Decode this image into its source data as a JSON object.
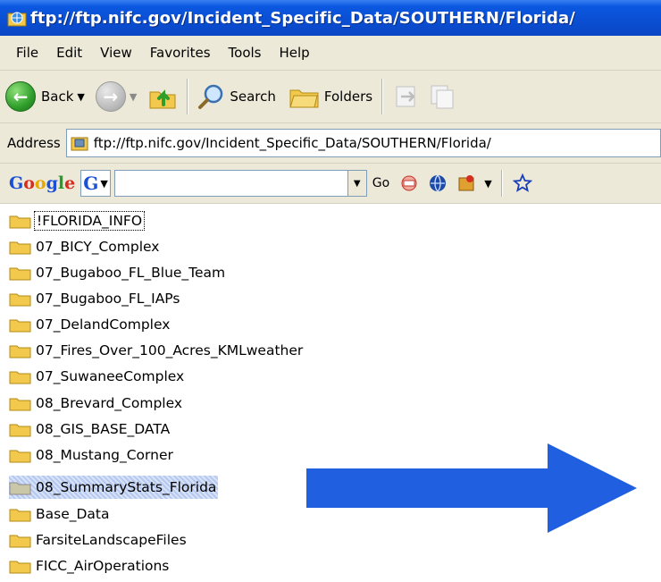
{
  "window": {
    "title": "ftp://ftp.nifc.gov/Incident_Specific_Data/SOUTHERN/Florida/"
  },
  "menu": [
    "File",
    "Edit",
    "View",
    "Favorites",
    "Tools",
    "Help"
  ],
  "toolbar": {
    "back_label": "Back",
    "search_label": "Search",
    "folders_label": "Folders"
  },
  "address": {
    "label": "Address",
    "url": "ftp://ftp.nifc.gov/Incident_Specific_Data/SOUTHERN/Florida/"
  },
  "google_bar": {
    "logo": "Google",
    "go_label": "Go"
  },
  "folders": [
    "!FLORIDA_INFO",
    "07_BICY_Complex",
    "07_Bugaboo_FL_Blue_Team",
    "07_Bugaboo_FL_IAPs",
    "07_DelandComplex",
    "07_Fires_Over_100_Acres_KMLweather",
    "07_SuwaneeComplex",
    "08_Brevard_Complex",
    "08_GIS_BASE_DATA",
    "08_Mustang_Corner",
    "08_SummaryStats_Florida",
    "Base_Data",
    "FarsiteLandscapeFiles",
    "FICC_AirOperations"
  ],
  "selected_folder": "08_SummaryStats_Florida",
  "colors": {
    "titlebar": "#0a4fd4",
    "chrome": "#ece9d8",
    "arrow": "#1f5fe0",
    "selection": "#b5c8f0"
  }
}
